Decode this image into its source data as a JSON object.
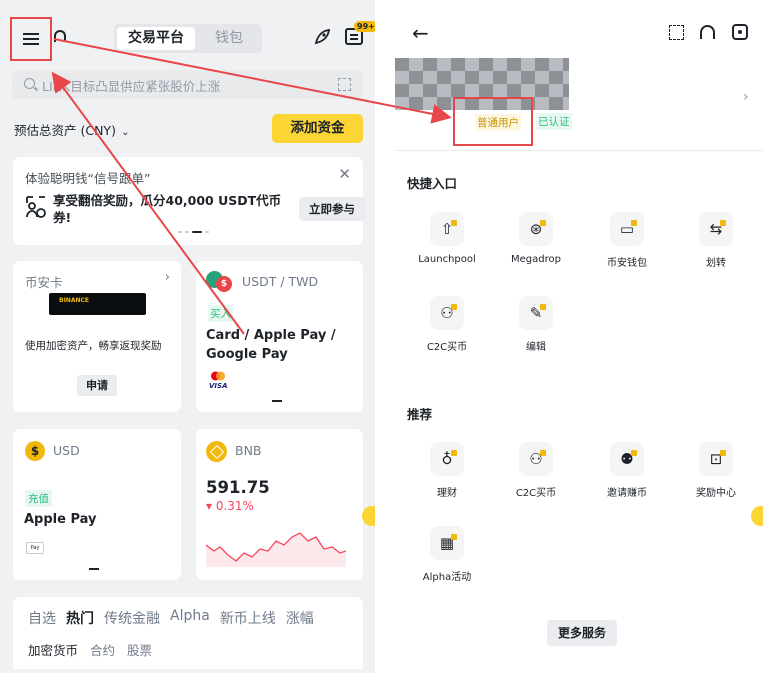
{
  "left": {
    "topbar": {
      "segment_active": "交易平台",
      "segment_inactive": "钱包",
      "notif_badge": "99+"
    },
    "search": {
      "placeholder": "LINK目标凸显供应紧张股价上涨"
    },
    "assets": {
      "label": "预估总资产 (CNY)",
      "add_funds": "添加资金"
    },
    "promo": {
      "title": "体验聪明钱“信号跟单”",
      "body": "享受翻倍奖励，瓜分40,000 USDT代币券!",
      "button": "立即参与"
    },
    "binance_card": {
      "title": "币安卡",
      "card_text": "BINANCE",
      "desc": "使用加密资产，畅享返现奖励",
      "button": "申请"
    },
    "usdt_card": {
      "coin_glyph": "$",
      "pair": "USDT / TWD",
      "tag": "买入",
      "main": "Card / Apple Pay / Google Pay",
      "brand": "VISA"
    },
    "usd_card": {
      "coin_glyph": "$",
      "name": "USD",
      "tag": "充值",
      "main": "Apple Pay",
      "pay_badge": "Pay"
    },
    "bnb_card": {
      "name": "BNB",
      "price": "591.75",
      "change": "▾ 0.31%"
    },
    "market_tabs": [
      "自选",
      "热门",
      "传统金融",
      "Alpha",
      "新币上线",
      "涨幅"
    ],
    "market_subtabs": [
      "加密货币",
      "合约",
      "股票"
    ],
    "colors": {
      "accent": "#fcd535",
      "up": "#2ebd85",
      "down": "#f6465d",
      "annotation": "#e8474a"
    }
  },
  "right": {
    "user_tag": "普通用户",
    "verified": "已认证",
    "quick_title": "快捷入口",
    "quick_items": [
      {
        "label": "Launchpool",
        "icon": "rocket-icon",
        "glyph": "⇧"
      },
      {
        "label": "Megadrop",
        "icon": "parachute-icon",
        "glyph": "⊛"
      },
      {
        "label": "币安钱包",
        "icon": "wallet-icon",
        "glyph": "▭"
      },
      {
        "label": "划转",
        "icon": "transfer-icon",
        "glyph": "⇆"
      },
      {
        "label": "C2C买币",
        "icon": "c2c-icon",
        "glyph": "⚇"
      },
      {
        "label": "编辑",
        "icon": "edit-icon",
        "glyph": "✎"
      }
    ],
    "rec_title": "推荐",
    "rec_items": [
      {
        "label": "理财",
        "icon": "finance-bag-icon",
        "glyph": "♁"
      },
      {
        "label": "C2C买币",
        "icon": "c2c-icon",
        "glyph": "⚇"
      },
      {
        "label": "邀请赚币",
        "icon": "invite-icon",
        "glyph": "⚉"
      },
      {
        "label": "奖励中心",
        "icon": "rewards-icon",
        "glyph": "⊡"
      },
      {
        "label": "Alpha活动",
        "icon": "alpha-calendar-icon",
        "glyph": "▦"
      }
    ],
    "more_button": "更多服务"
  }
}
